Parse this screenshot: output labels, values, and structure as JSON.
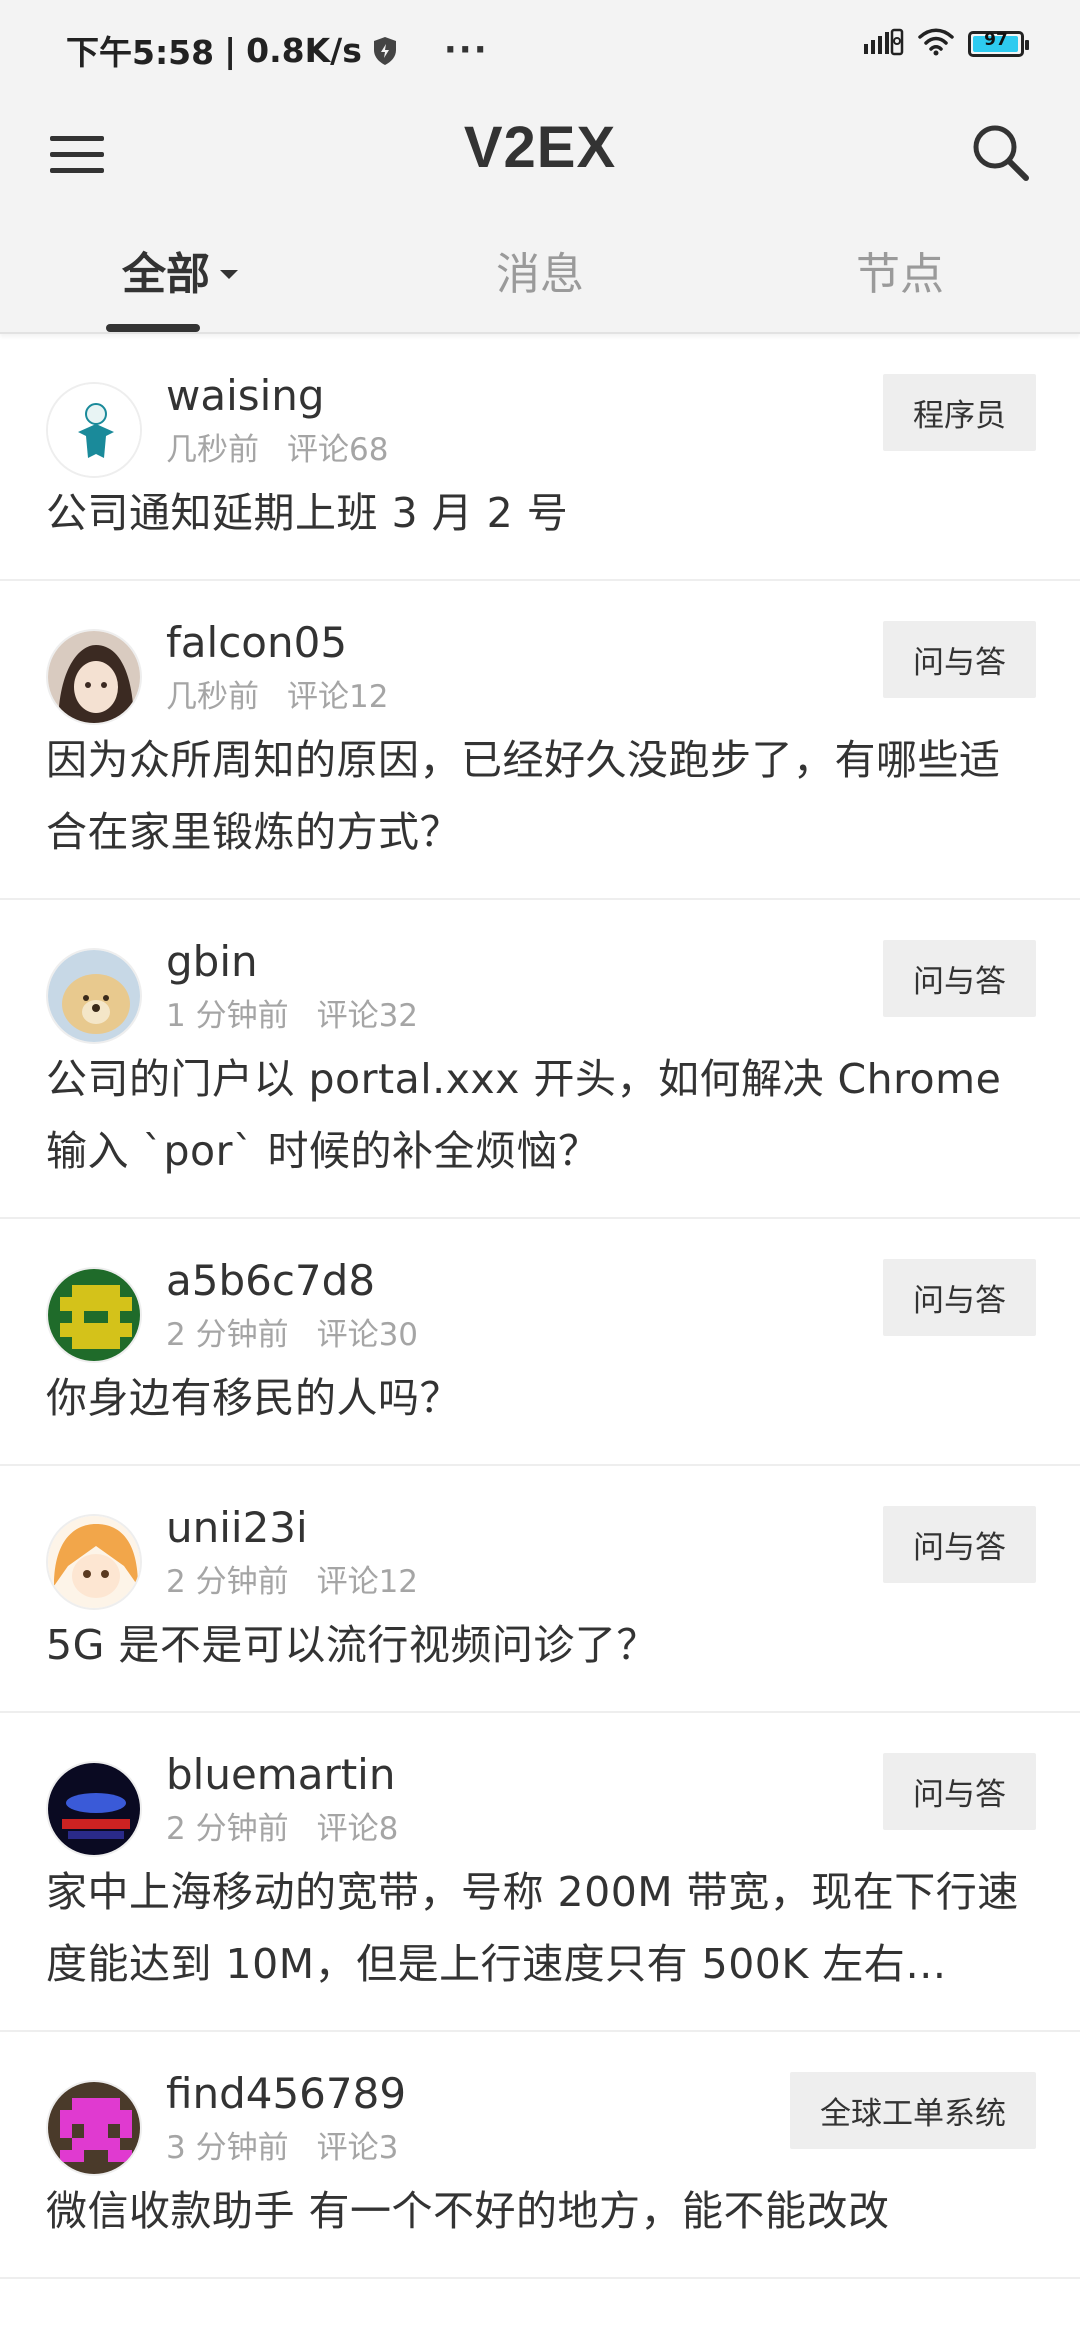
{
  "status_bar": {
    "time": "下午5:58",
    "separator": "|",
    "speed": "0.8K/s",
    "more": "···",
    "battery": "97"
  },
  "app_bar": {
    "title": "V2EX"
  },
  "tabs": [
    {
      "label": "全部",
      "active": true
    },
    {
      "label": "消息",
      "active": false
    },
    {
      "label": "节点",
      "active": false
    }
  ],
  "posts": [
    {
      "user": "waising",
      "time": "几秒前",
      "comments": "评论68",
      "node": "程序员",
      "title": "公司通知延期上班 3 月 2 号"
    },
    {
      "user": "falcon05",
      "time": "几秒前",
      "comments": "评论12",
      "node": "问与答",
      "title": "因为众所周知的原因，已经好久没跑步了，有哪些适合在家里锻炼的方式？"
    },
    {
      "user": "gbin",
      "time": "1 分钟前",
      "comments": "评论32",
      "node": "问与答",
      "title": "公司的门户以 portal.xxx 开头，如何解决 Chrome 输入 `por` 时候的补全烦恼？"
    },
    {
      "user": "a5b6c7d8",
      "time": "2 分钟前",
      "comments": "评论30",
      "node": "问与答",
      "title": "你身边有移民的人吗？"
    },
    {
      "user": "unii23i",
      "time": "2 分钟前",
      "comments": "评论12",
      "node": "问与答",
      "title": "5G 是不是可以流行视频问诊了？"
    },
    {
      "user": "bluemartin",
      "time": "2 分钟前",
      "comments": "评论8",
      "node": "问与答",
      "title": "家中上海移动的宽带，号称 200M 带宽，现在下行速度能达到 10M，但是上行速度只有 500K 左右…"
    },
    {
      "user": "find456789",
      "time": "3 分钟前",
      "comments": "评论3",
      "node": "全球工单系统",
      "title": "微信收款助手 有一个不好的地方，能不能改改"
    }
  ]
}
